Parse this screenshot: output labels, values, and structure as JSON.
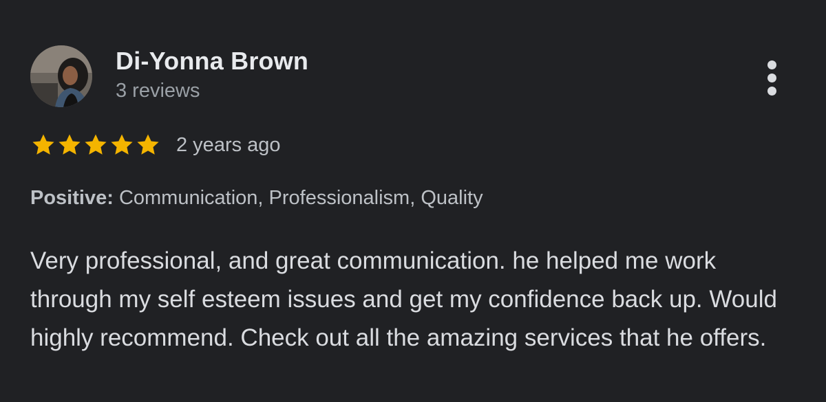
{
  "review": {
    "author": {
      "name": "Di-Yonna Brown",
      "review_count": "3 reviews",
      "avatar_icon": "user-photo-avatar"
    },
    "rating": {
      "stars": 5,
      "max_stars": 5,
      "star_color": "#f4b400"
    },
    "date": "2 years ago",
    "highlights": {
      "label": "Positive:",
      "value": "Communication, Professionalism, Quality"
    },
    "text": "Very professional, and great communication. he helped me work through my self esteem issues and get my confidence back up. Would highly recommend. Check out all the amazing services that he offers.",
    "more_icon": "more-vert-icon"
  },
  "colors": {
    "background": "#202124",
    "primary_text": "#e8eaed",
    "secondary_text": "#9aa0a6"
  }
}
